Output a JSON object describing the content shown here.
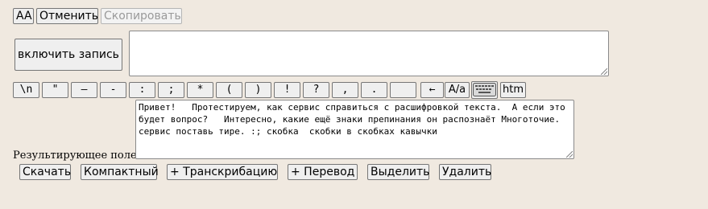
{
  "top_toolbar": {
    "aa_label": "AA",
    "cancel_label": "Отменить",
    "copy_label": "Скопировать"
  },
  "record": {
    "button_label": "включить запись",
    "input_value": ""
  },
  "keys": [
    "\\n",
    "\"",
    "—",
    "-",
    ":",
    ";",
    "*",
    "(",
    ")",
    "!",
    "?",
    ",",
    ".",
    "",
    "←",
    "A/a",
    "keyboard-icon",
    "htm"
  ],
  "result": {
    "label": "Результирующее поле",
    "text": "Привет!   Протестируем, как сервис справиться с расшифровкой текста.  А если это будет вопрос?   Интересно, какие ещё знаки препинания он распознаёт Многоточие. сервис поставь тире. :; скобка  скобки в скобках кавычки"
  },
  "actions": {
    "download": "Скачать",
    "compact": "Компактный",
    "add_transcription": "+ Транскрибацию",
    "add_translation": "+ Перевод",
    "select": "Выделить",
    "delete": "Удалить"
  }
}
